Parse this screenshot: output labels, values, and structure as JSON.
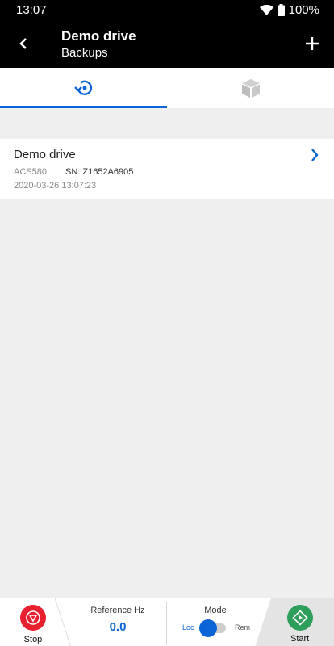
{
  "status_bar": {
    "time": "13:07",
    "battery": "100%"
  },
  "app_bar": {
    "title": "Demo drive",
    "subtitle": "Backups"
  },
  "tabs": [
    {
      "icon": "backup-history-icon",
      "active": true
    },
    {
      "icon": "package-box-icon",
      "active": false
    }
  ],
  "backup_item": {
    "name": "Demo drive",
    "model": "ACS580",
    "serial": "SN: Z1652A6905",
    "timestamp": "2020-03-26 13:07:23"
  },
  "bottom_bar": {
    "stop_label": "Stop",
    "reference_label": "Reference Hz",
    "reference_value": "0.0",
    "mode_label": "Mode",
    "mode_local": "Loc",
    "mode_remote": "Rem",
    "start_label": "Start"
  },
  "colors": {
    "accent": "#0a64d6",
    "stop": "#e8202f",
    "start": "#2e9e5b",
    "app_bar": "#000000"
  }
}
